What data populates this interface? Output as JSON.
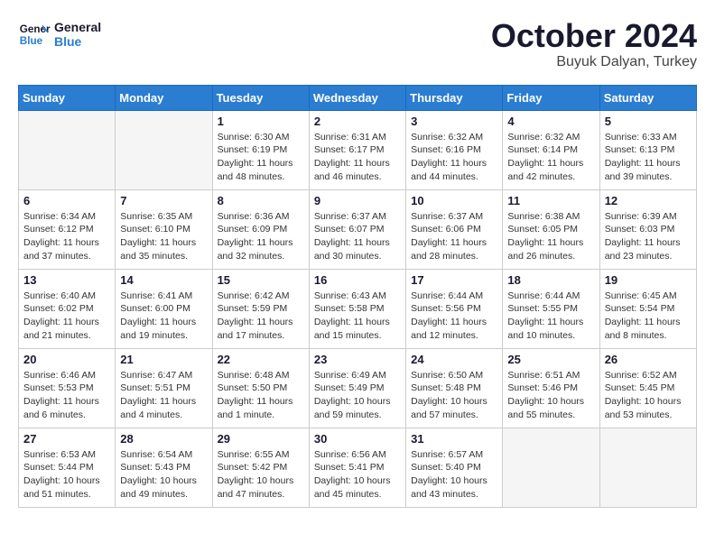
{
  "header": {
    "logo_line1": "General",
    "logo_line2": "Blue",
    "month": "October 2024",
    "location": "Buyuk Dalyan, Turkey"
  },
  "weekdays": [
    "Sunday",
    "Monday",
    "Tuesday",
    "Wednesday",
    "Thursday",
    "Friday",
    "Saturday"
  ],
  "weeks": [
    [
      {
        "day": "",
        "info": ""
      },
      {
        "day": "",
        "info": ""
      },
      {
        "day": "1",
        "info": "Sunrise: 6:30 AM\nSunset: 6:19 PM\nDaylight: 11 hours and 48 minutes."
      },
      {
        "day": "2",
        "info": "Sunrise: 6:31 AM\nSunset: 6:17 PM\nDaylight: 11 hours and 46 minutes."
      },
      {
        "day": "3",
        "info": "Sunrise: 6:32 AM\nSunset: 6:16 PM\nDaylight: 11 hours and 44 minutes."
      },
      {
        "day": "4",
        "info": "Sunrise: 6:32 AM\nSunset: 6:14 PM\nDaylight: 11 hours and 42 minutes."
      },
      {
        "day": "5",
        "info": "Sunrise: 6:33 AM\nSunset: 6:13 PM\nDaylight: 11 hours and 39 minutes."
      }
    ],
    [
      {
        "day": "6",
        "info": "Sunrise: 6:34 AM\nSunset: 6:12 PM\nDaylight: 11 hours and 37 minutes."
      },
      {
        "day": "7",
        "info": "Sunrise: 6:35 AM\nSunset: 6:10 PM\nDaylight: 11 hours and 35 minutes."
      },
      {
        "day": "8",
        "info": "Sunrise: 6:36 AM\nSunset: 6:09 PM\nDaylight: 11 hours and 32 minutes."
      },
      {
        "day": "9",
        "info": "Sunrise: 6:37 AM\nSunset: 6:07 PM\nDaylight: 11 hours and 30 minutes."
      },
      {
        "day": "10",
        "info": "Sunrise: 6:37 AM\nSunset: 6:06 PM\nDaylight: 11 hours and 28 minutes."
      },
      {
        "day": "11",
        "info": "Sunrise: 6:38 AM\nSunset: 6:05 PM\nDaylight: 11 hours and 26 minutes."
      },
      {
        "day": "12",
        "info": "Sunrise: 6:39 AM\nSunset: 6:03 PM\nDaylight: 11 hours and 23 minutes."
      }
    ],
    [
      {
        "day": "13",
        "info": "Sunrise: 6:40 AM\nSunset: 6:02 PM\nDaylight: 11 hours and 21 minutes."
      },
      {
        "day": "14",
        "info": "Sunrise: 6:41 AM\nSunset: 6:00 PM\nDaylight: 11 hours and 19 minutes."
      },
      {
        "day": "15",
        "info": "Sunrise: 6:42 AM\nSunset: 5:59 PM\nDaylight: 11 hours and 17 minutes."
      },
      {
        "day": "16",
        "info": "Sunrise: 6:43 AM\nSunset: 5:58 PM\nDaylight: 11 hours and 15 minutes."
      },
      {
        "day": "17",
        "info": "Sunrise: 6:44 AM\nSunset: 5:56 PM\nDaylight: 11 hours and 12 minutes."
      },
      {
        "day": "18",
        "info": "Sunrise: 6:44 AM\nSunset: 5:55 PM\nDaylight: 11 hours and 10 minutes."
      },
      {
        "day": "19",
        "info": "Sunrise: 6:45 AM\nSunset: 5:54 PM\nDaylight: 11 hours and 8 minutes."
      }
    ],
    [
      {
        "day": "20",
        "info": "Sunrise: 6:46 AM\nSunset: 5:53 PM\nDaylight: 11 hours and 6 minutes."
      },
      {
        "day": "21",
        "info": "Sunrise: 6:47 AM\nSunset: 5:51 PM\nDaylight: 11 hours and 4 minutes."
      },
      {
        "day": "22",
        "info": "Sunrise: 6:48 AM\nSunset: 5:50 PM\nDaylight: 11 hours and 1 minute."
      },
      {
        "day": "23",
        "info": "Sunrise: 6:49 AM\nSunset: 5:49 PM\nDaylight: 10 hours and 59 minutes."
      },
      {
        "day": "24",
        "info": "Sunrise: 6:50 AM\nSunset: 5:48 PM\nDaylight: 10 hours and 57 minutes."
      },
      {
        "day": "25",
        "info": "Sunrise: 6:51 AM\nSunset: 5:46 PM\nDaylight: 10 hours and 55 minutes."
      },
      {
        "day": "26",
        "info": "Sunrise: 6:52 AM\nSunset: 5:45 PM\nDaylight: 10 hours and 53 minutes."
      }
    ],
    [
      {
        "day": "27",
        "info": "Sunrise: 6:53 AM\nSunset: 5:44 PM\nDaylight: 10 hours and 51 minutes."
      },
      {
        "day": "28",
        "info": "Sunrise: 6:54 AM\nSunset: 5:43 PM\nDaylight: 10 hours and 49 minutes."
      },
      {
        "day": "29",
        "info": "Sunrise: 6:55 AM\nSunset: 5:42 PM\nDaylight: 10 hours and 47 minutes."
      },
      {
        "day": "30",
        "info": "Sunrise: 6:56 AM\nSunset: 5:41 PM\nDaylight: 10 hours and 45 minutes."
      },
      {
        "day": "31",
        "info": "Sunrise: 6:57 AM\nSunset: 5:40 PM\nDaylight: 10 hours and 43 minutes."
      },
      {
        "day": "",
        "info": ""
      },
      {
        "day": "",
        "info": ""
      }
    ]
  ]
}
